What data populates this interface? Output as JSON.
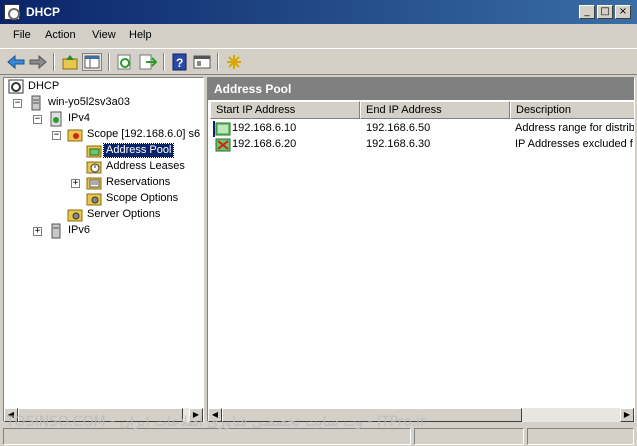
{
  "window": {
    "title": "DHCP",
    "controls": [
      "_",
      "□",
      "×"
    ]
  },
  "menu": [
    "File",
    "Action",
    "View",
    "Help"
  ],
  "toolbar": {
    "buttons": [
      "back-icon",
      "forward-icon",
      "up-folder-icon",
      "show-hide-tree-icon",
      "refresh-icon",
      "export-icon",
      "help-icon",
      "properties-icon",
      "new-icon"
    ]
  },
  "tree": {
    "root": "DHCP",
    "server": "win-yo5l2sv3a03",
    "ipv4": "IPv4",
    "scope": "Scope [192.168.6.0] s6",
    "address_pool": "Address Pool",
    "address_leases": "Address Leases",
    "reservations": "Reservations",
    "scope_options": "Scope Options",
    "server_options": "Server Options",
    "ipv6": "IPv6"
  },
  "details": {
    "header": "Address Pool",
    "columns": [
      "Start IP Address",
      "End IP Address",
      "Description"
    ],
    "rows": [
      {
        "start": "192.168.6.10",
        "end": "192.168.6.50",
        "description": "Address range for distrib"
      },
      {
        "start": "192.168.6.20",
        "end": "192.168.6.30",
        "description": "IP Addresses excluded f"
      }
    ]
  },
  "watermark": "TOSINSO.COM - وب سایت تخصصی فناوری اطلاعات ایران - ITPro.ir",
  "colors": {
    "title_bar": "#0a246a",
    "selection": "#0a246a",
    "pane_header": "#808080"
  }
}
